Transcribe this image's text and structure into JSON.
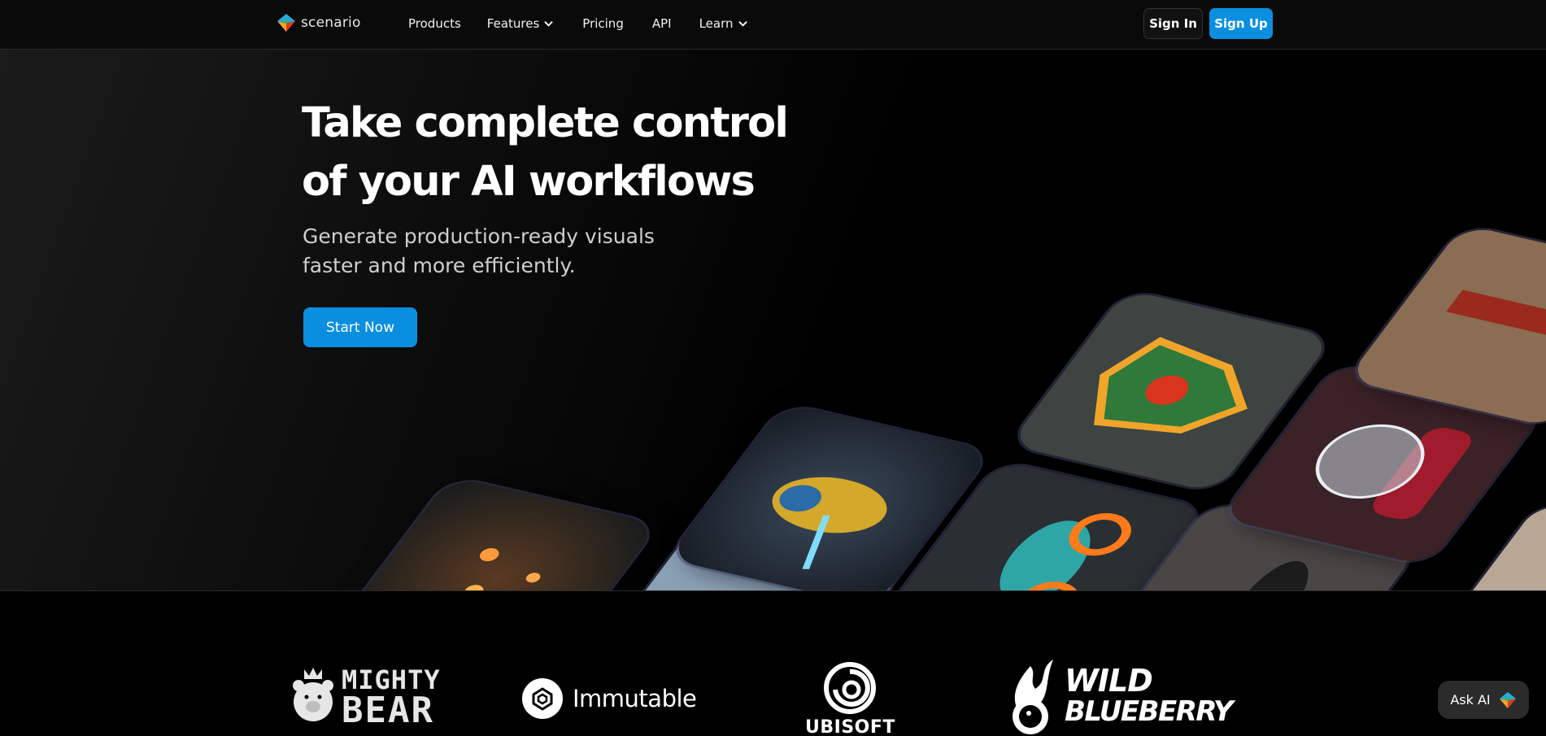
{
  "nav": {
    "logo_text": "scenario",
    "links": [
      {
        "label": "Products",
        "has_dropdown": false
      },
      {
        "label": "Features",
        "has_dropdown": true
      },
      {
        "label": "Pricing",
        "has_dropdown": false
      },
      {
        "label": "API",
        "has_dropdown": false
      },
      {
        "label": "Learn",
        "has_dropdown": true
      }
    ],
    "sign_in": "Sign In",
    "sign_up": "Sign Up"
  },
  "hero": {
    "title_line1": "Take complete control",
    "title_line2": "of your AI workflows",
    "subtitle_line1": "Generate production-ready visuals",
    "subtitle_line2": "faster and more efficiently.",
    "cta": "Start Now"
  },
  "brands": {
    "mighty_bear_line1": "MIGHTY",
    "mighty_bear_line2": "BEAR",
    "immutable": "Immutable",
    "ubisoft": "UBISOFT",
    "wild_blueberry_line1": "WILD",
    "wild_blueberry_line2": "BLUEBERRY"
  },
  "ask_ai": "Ask AI",
  "colors": {
    "accent": "#0a8fe0",
    "background": "#000000"
  }
}
